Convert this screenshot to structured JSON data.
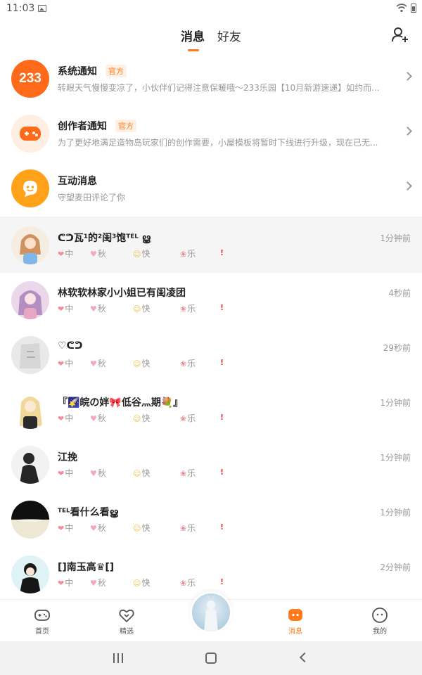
{
  "status_bar": {
    "time": "11:03"
  },
  "top_tabs": {
    "messages": "消息",
    "friends": "好友"
  },
  "notifications": [
    {
      "title": "系统通知",
      "badge": "官方",
      "desc": "转眼天气慢慢变凉了，小伙伴们记得注意保暖哦～233乐园【10月新游速递】如约而...",
      "avatar_text": "233",
      "icon": "233-logo-icon",
      "color": "#ff6a1a"
    },
    {
      "title": "创作者通知",
      "badge": "官方",
      "desc": "为了更好地满足造物岛玩家们的创作需要，小屋模板将暂时下线进行升级，现在已无...",
      "icon": "gamepad-icon",
      "color": "#ff6a1a"
    },
    {
      "title": "互动消息",
      "badge": "",
      "desc": "守望麦田评论了你",
      "icon": "chat-bubble-icon",
      "color": "#ffa21a"
    }
  ],
  "tag_labels": [
    "中",
    "秋",
    "快",
    "乐",
    ""
  ],
  "tag_glyphs": [
    "❤",
    "♥",
    "☺",
    "❀",
    "!"
  ],
  "chats": [
    {
      "name": "ᕦᕤ瓦¹的²闺³饱ᵀᴱᴸ ൠ",
      "time": "1分钟前",
      "avatar": "avatar-anime-girl-icon"
    },
    {
      "name": "林软软林家小小姐已有闺凌团",
      "time": "4秒前",
      "avatar": "avatar-purple-girl-icon"
    },
    {
      "name": "♡ᕦᕤ",
      "time": "29秒前",
      "avatar": "avatar-gray-icon"
    },
    {
      "name": "『🌠皖の姅🎀低谷灬期💐』",
      "time": "1分钟前",
      "avatar": "avatar-blonde-girl-icon"
    },
    {
      "name": "江挽",
      "time": "1分钟前",
      "avatar": "avatar-dark-icon"
    },
    {
      "name": "ᵀᴱᴸ看什么看ൠ",
      "time": "1分钟前",
      "avatar": "avatar-moon-icon"
    },
    {
      "name": "[]南玉高♛[]",
      "time": "2分钟前",
      "avatar": "avatar-boy-icon"
    }
  ],
  "bottom_nav": {
    "home": "首页",
    "featured": "精选",
    "messages": "消息",
    "profile": "我的"
  },
  "colors": {
    "accent": "#ff7a1a",
    "badge_bg": "#fff0e3"
  }
}
